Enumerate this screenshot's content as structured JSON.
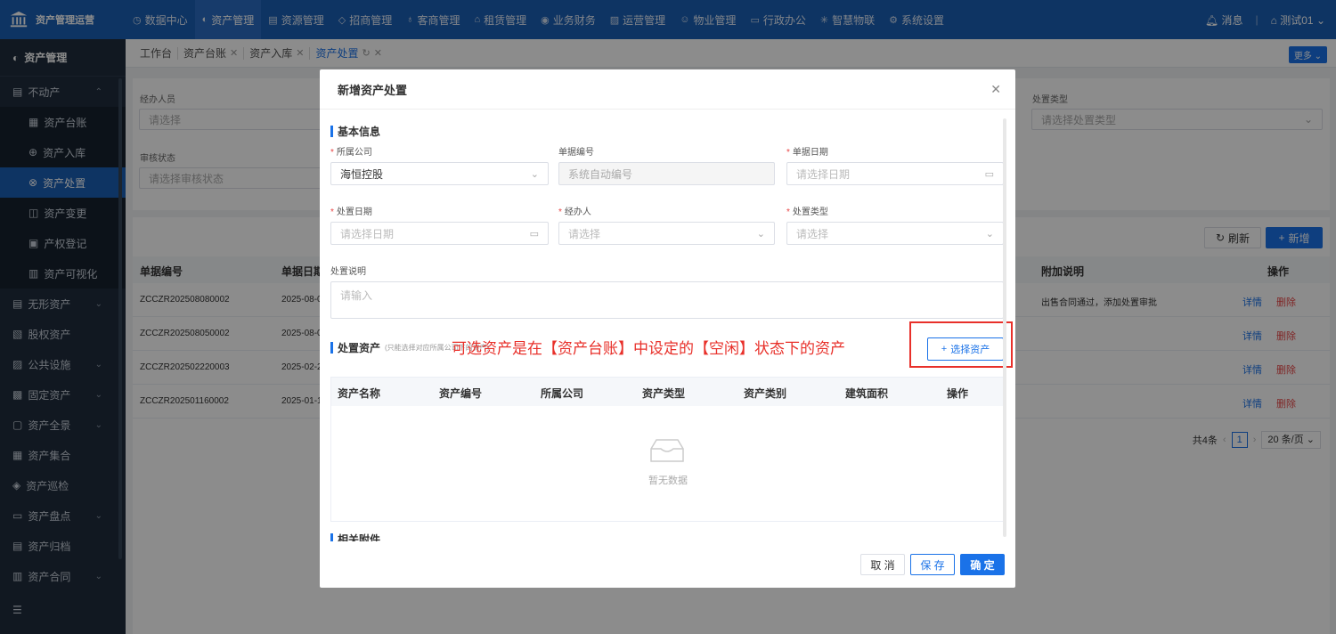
{
  "topbar": {
    "brand": "资产管理运营",
    "nav": [
      {
        "label": "数据中心",
        "icon": "clock-icon"
      },
      {
        "label": "资产管理",
        "icon": "cube-icon",
        "active": true
      },
      {
        "label": "资源管理",
        "icon": "building-icon"
      },
      {
        "label": "招商管理",
        "icon": "diamond-icon"
      },
      {
        "label": "客商管理",
        "icon": "people-icon"
      },
      {
        "label": "租赁管理",
        "icon": "house-icon"
      },
      {
        "label": "业务财务",
        "icon": "coin-icon"
      },
      {
        "label": "运营管理",
        "icon": "chart-icon"
      },
      {
        "label": "物业管理",
        "icon": "smile-icon"
      },
      {
        "label": "行政办公",
        "icon": "monitor-icon"
      },
      {
        "label": "智慧物联",
        "icon": "network-icon"
      },
      {
        "label": "系统设置",
        "icon": "gear-icon"
      }
    ],
    "messages": "消息",
    "user": "测试01"
  },
  "sidebar": {
    "title": "资产管理",
    "items": [
      {
        "label": "不动产",
        "icon": "building-icon",
        "chev": "⌃"
      },
      {
        "label": "资产台账",
        "icon": "ledger-icon",
        "sub": true
      },
      {
        "label": "资产入库",
        "icon": "inbound-icon",
        "sub": true
      },
      {
        "label": "资产处置",
        "icon": "dispose-icon",
        "sub": true,
        "active": true
      },
      {
        "label": "资产变更",
        "icon": "change-icon",
        "sub": true
      },
      {
        "label": "产权登记",
        "icon": "register-icon",
        "sub": true
      },
      {
        "label": "资产可视化",
        "icon": "visual-icon",
        "sub": true
      },
      {
        "label": "无形资产",
        "icon": "intangible-icon",
        "chev": "⌄"
      },
      {
        "label": "股权资产",
        "icon": "equity-icon"
      },
      {
        "label": "公共设施",
        "icon": "facility-icon",
        "chev": "⌄"
      },
      {
        "label": "固定资产",
        "icon": "fixed-icon",
        "chev": "⌄"
      },
      {
        "label": "资产全景",
        "icon": "panorama-icon",
        "chev": "⌄"
      },
      {
        "label": "资产集合",
        "icon": "grid-icon"
      },
      {
        "label": "资产巡检",
        "icon": "inspect-icon"
      },
      {
        "label": "资产盘点",
        "icon": "inventory-icon",
        "chev": "⌄"
      },
      {
        "label": "资产归档",
        "icon": "archive-icon"
      },
      {
        "label": "资产合同",
        "icon": "contract-icon",
        "chev": "⌄"
      }
    ]
  },
  "tabs": [
    {
      "label": "工作台",
      "closable": false
    },
    {
      "label": "资产台账",
      "closable": true
    },
    {
      "label": "资产入库",
      "closable": true
    },
    {
      "label": "资产处置",
      "closable": true,
      "active": true
    }
  ],
  "more_label": "更多",
  "filters": {
    "handler_label": "经办人员",
    "handler_placeholder": "请选择",
    "review_label": "审核状态",
    "review_placeholder": "请选择审核状态",
    "type_label": "处置类型",
    "type_placeholder": "请选择处置类型"
  },
  "toolbar": {
    "refresh": "刷新",
    "add": "新增"
  },
  "table": {
    "headers": [
      "单据编号",
      "单据日期",
      "附加说明",
      "操作"
    ],
    "rows": [
      {
        "code": "ZCCZR202508080002",
        "date": "2025-08-0",
        "note": "出售合同通过，添加处置审批"
      },
      {
        "code": "ZCCZR202508050002",
        "date": "2025-08-0",
        "note": ""
      },
      {
        "code": "ZCCZR202502220003",
        "date": "2025-02-2",
        "note": ""
      },
      {
        "code": "ZCCZR202501160002",
        "date": "2025-01-1",
        "note": ""
      }
    ],
    "detail": "详情",
    "delete": "删除"
  },
  "pager": {
    "total": "共4条",
    "page": "1",
    "size": "20 条/页"
  },
  "modal": {
    "title": "新增资产处置",
    "basic_section": "基本信息",
    "company_label": "所属公司",
    "company_value": "海恒控股",
    "code_label": "单据编号",
    "code_placeholder": "系统自动编号",
    "doc_date_label": "单据日期",
    "doc_date_placeholder": "请选择日期",
    "dispose_date_label": "处置日期",
    "dispose_date_placeholder": "请选择日期",
    "handler_label": "经办人",
    "handler_placeholder": "请选择",
    "type_label": "处置类型",
    "type_placeholder": "请选择",
    "desc_label": "处置说明",
    "desc_placeholder": "请输入",
    "asset_section": "处置资产",
    "asset_hint": "(只能选择对应所属公司下的资产)",
    "annotation": "可选资产是在【资产台账】中设定的【空闲】状态下的资产",
    "select_asset": "选择资产",
    "asset_headers": [
      "资产名称",
      "资产编号",
      "所属公司",
      "资产类型",
      "资产类别",
      "建筑面积",
      "操作"
    ],
    "empty": "暂无数据",
    "attach_section": "相关附件",
    "cancel": "取 消",
    "save": "保 存",
    "ok": "确 定"
  },
  "colors": {
    "primary": "#1a72e8",
    "topbar": "#1a5fb4",
    "sidebar": "#1f2d3d",
    "danger": "#e84545",
    "annotation": "#e8302a"
  }
}
